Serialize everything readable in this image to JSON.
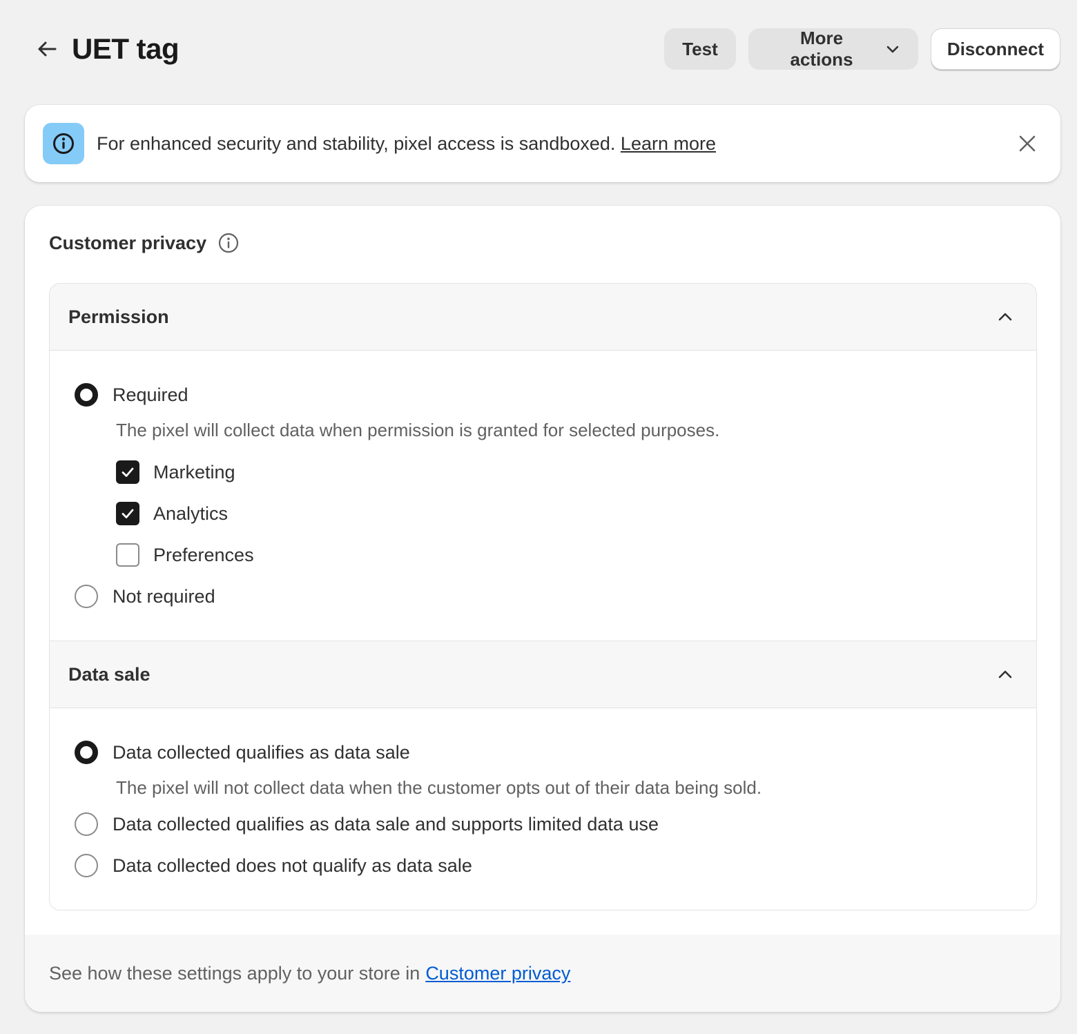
{
  "header": {
    "back_icon": "arrow-left-icon",
    "title": "UET tag",
    "actions": {
      "test_label": "Test",
      "more_actions_label": "More actions",
      "more_actions_icon": "chevron-down-icon",
      "disconnect_label": "Disconnect"
    }
  },
  "banner": {
    "icon": "info-icon",
    "icon_bg_color": "#84cbf7",
    "text": "For enhanced security and stability, pixel access is sandboxed.",
    "link_label": "Learn more",
    "dismiss_icon": "close-icon"
  },
  "customer_privacy": {
    "title": "Customer privacy",
    "info_icon": "info-outline-icon",
    "permission": {
      "title": "Permission",
      "expanded": true,
      "options": [
        {
          "label": "Required",
          "selected": true,
          "help": "The pixel will collect data when permission is granted for selected purposes.",
          "purposes": [
            {
              "label": "Marketing",
              "checked": true
            },
            {
              "label": "Analytics",
              "checked": true
            },
            {
              "label": "Preferences",
              "checked": false
            }
          ]
        },
        {
          "label": "Not required",
          "selected": false
        }
      ]
    },
    "data_sale": {
      "title": "Data sale",
      "expanded": true,
      "options": [
        {
          "label": "Data collected qualifies as data sale",
          "selected": true,
          "help": "The pixel will not collect data when the customer opts out of their data being sold."
        },
        {
          "label": "Data collected qualifies as data sale and supports limited data use",
          "selected": false
        },
        {
          "label": "Data collected does not qualify as data sale",
          "selected": false
        }
      ]
    },
    "footer": {
      "text": "See how these settings apply to your store in",
      "link_label": "Customer privacy",
      "link_color": "#005bd3"
    }
  }
}
